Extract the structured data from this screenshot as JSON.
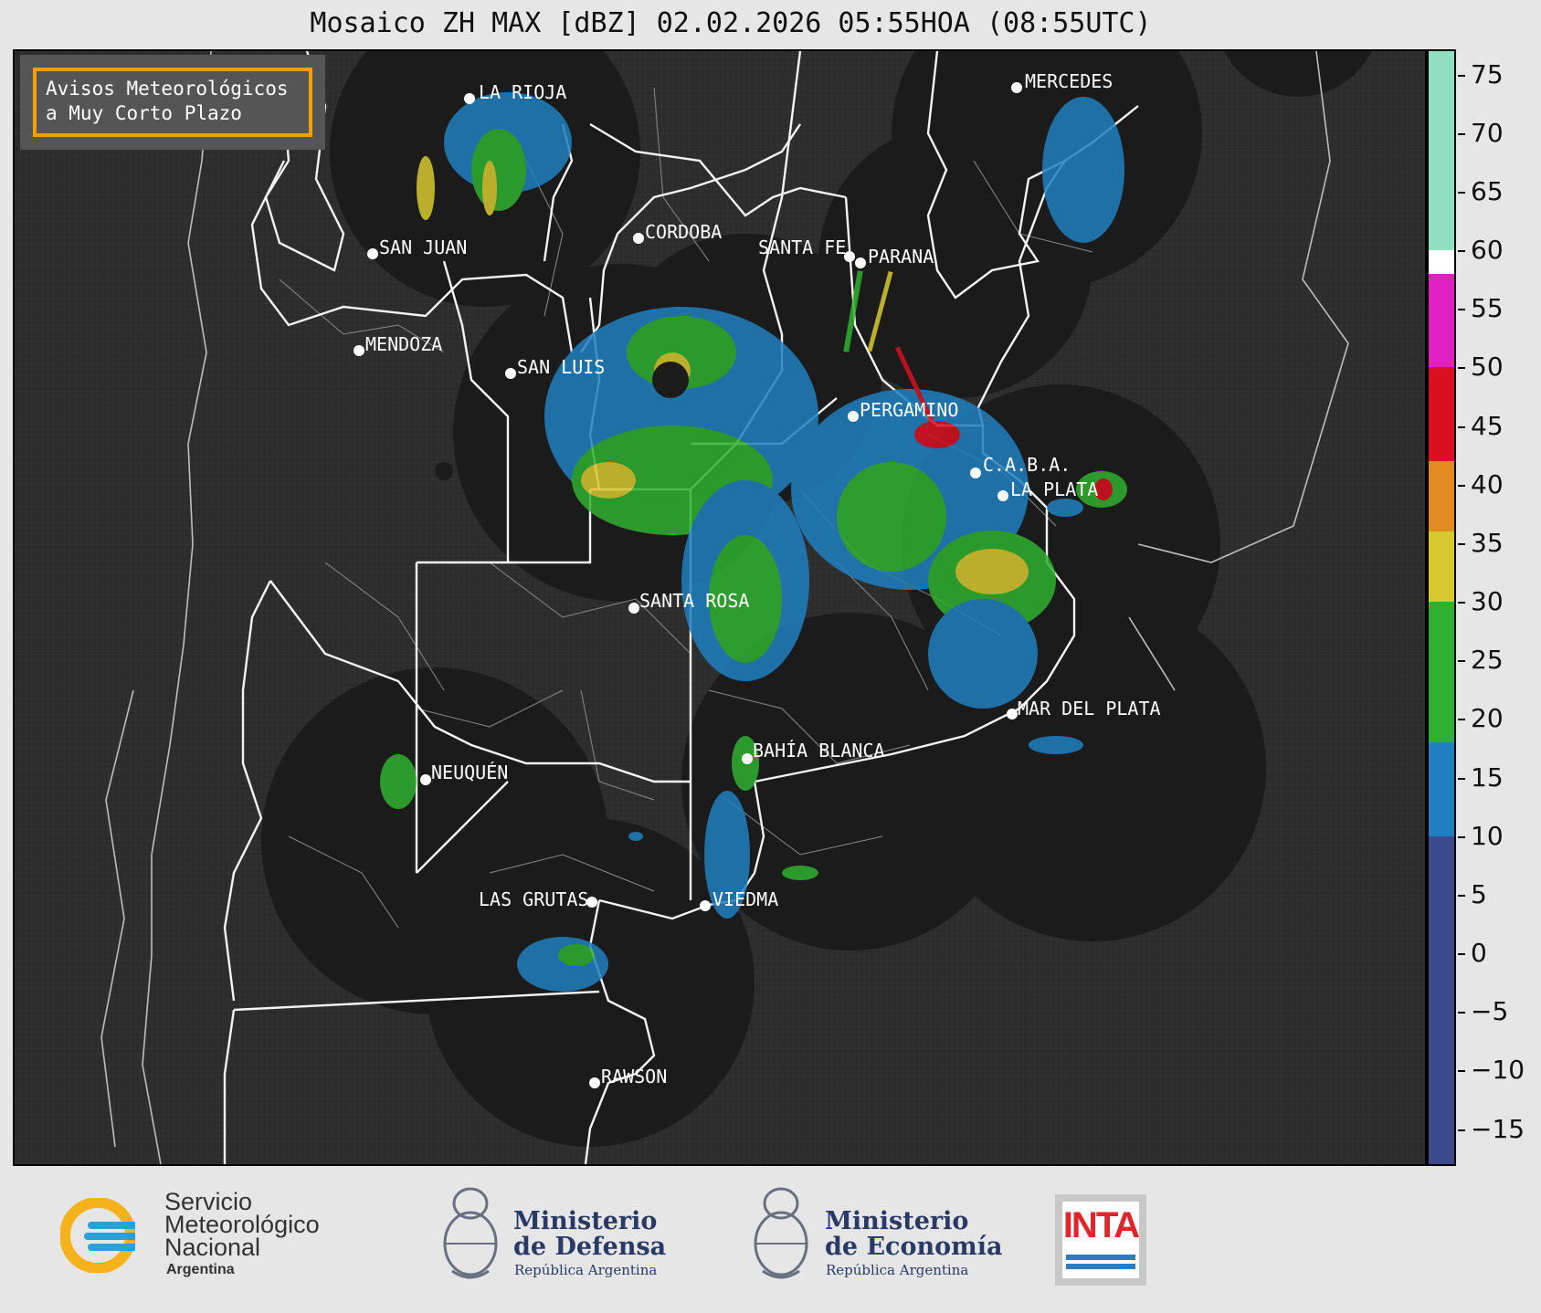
{
  "title": "Mosaico ZH MAX [dBZ] 02.02.2026 05:55HOA (08:55UTC)",
  "legend_box": {
    "line1": "Avisos Meteorológicos",
    "line2": "a Muy Corto Plazo"
  },
  "colorbar": {
    "ticks": [
      "75",
      "70",
      "65",
      "60",
      "55",
      "50",
      "45",
      "40",
      "35",
      "30",
      "25",
      "20",
      "15",
      "10",
      "5",
      "0",
      "−5",
      "−10",
      "−15"
    ],
    "range_dbz": [
      -18,
      77
    ],
    "bands": [
      {
        "from": -18,
        "to": 18,
        "color": "#3a4a8a"
      },
      {
        "from": 10,
        "to": 18,
        "color": "#1f7fc0"
      },
      {
        "from": 18,
        "to": 30,
        "color": "#30b030"
      },
      {
        "from": 30,
        "to": 42,
        "color": "#d8c830"
      },
      {
        "from": 36,
        "to": 42,
        "color": "#e08a20"
      },
      {
        "from": 42,
        "to": 50,
        "color": "#d81020"
      },
      {
        "from": 50,
        "to": 58,
        "color": "#e020c0"
      },
      {
        "from": 58,
        "to": 60,
        "color": "#ffffff"
      },
      {
        "from": 60,
        "to": 77,
        "color": "#8ee0c0"
      }
    ]
  },
  "cities": [
    {
      "name": "LA RIOJA"
    },
    {
      "name": "MERCEDES"
    },
    {
      "name": "CORDOBA"
    },
    {
      "name": "SAN JUAN"
    },
    {
      "name": "SANTA FE"
    },
    {
      "name": "PARANA"
    },
    {
      "name": "MENDOZA"
    },
    {
      "name": "SAN LUIS"
    },
    {
      "name": "PERGAMINO"
    },
    {
      "name": "C.A.B.A."
    },
    {
      "name": "LA PLATA"
    },
    {
      "name": "SANTA ROSA"
    },
    {
      "name": "MAR DEL PLATA"
    },
    {
      "name": "BAHÍA BLANCA"
    },
    {
      "name": "NEUQUÉN"
    },
    {
      "name": "LAS GRUTAS"
    },
    {
      "name": "VIEDMA"
    },
    {
      "name": "RAWSON"
    }
  ],
  "footer": {
    "smn": {
      "line1": "Servicio",
      "line2": "Meteorológico",
      "line3": "Nacional",
      "line4": "Argentina"
    },
    "defensa": {
      "line1": "Ministerio",
      "line2": "de Defensa",
      "sub": "República Argentina"
    },
    "economia": {
      "line1": "Ministerio",
      "line2": "de Economía",
      "sub": "República Argentina"
    },
    "inta": "INTA"
  }
}
